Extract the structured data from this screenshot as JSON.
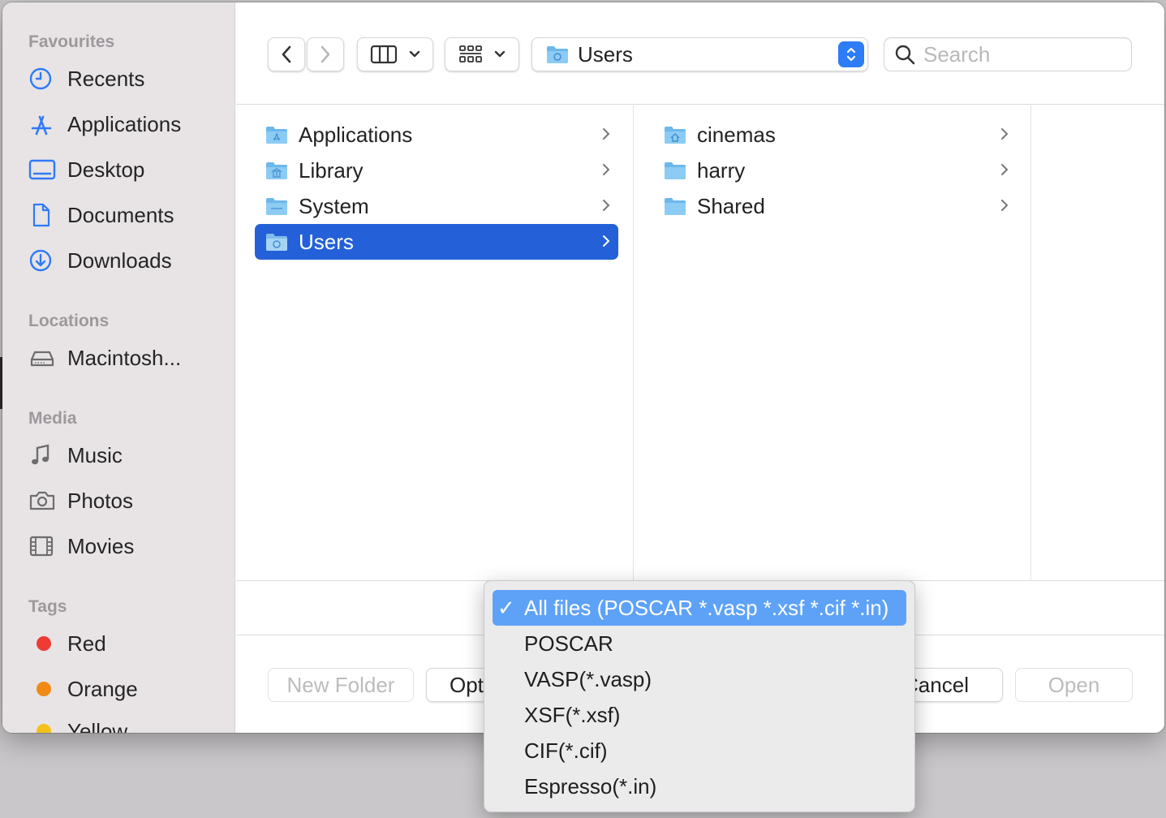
{
  "sidebar": {
    "sections": [
      {
        "heading": "Favourites",
        "items": [
          {
            "label": "Recents",
            "icon": "clock-icon"
          },
          {
            "label": "Applications",
            "icon": "applications-icon"
          },
          {
            "label": "Desktop",
            "icon": "desktop-icon"
          },
          {
            "label": "Documents",
            "icon": "document-icon"
          },
          {
            "label": "Downloads",
            "icon": "download-icon"
          }
        ]
      },
      {
        "heading": "Locations",
        "items": [
          {
            "label": "Macintosh...",
            "icon": "hard-drive-icon"
          }
        ]
      },
      {
        "heading": "Media",
        "items": [
          {
            "label": "Music",
            "icon": "music-note-icon"
          },
          {
            "label": "Photos",
            "icon": "camera-icon"
          },
          {
            "label": "Movies",
            "icon": "film-icon"
          }
        ]
      },
      {
        "heading": "Tags",
        "items": [
          {
            "label": "Red",
            "color": "#ee3b35"
          },
          {
            "label": "Orange",
            "color": "#f08a14"
          },
          {
            "label": "Yellow",
            "color": "#f3c21a"
          }
        ]
      }
    ]
  },
  "toolbar": {
    "path_label": "Users",
    "search_placeholder": "Search"
  },
  "columns": [
    {
      "items": [
        {
          "label": "Applications",
          "icon": "applications-folder-icon",
          "selected": false
        },
        {
          "label": "Library",
          "icon": "library-folder-icon",
          "selected": false
        },
        {
          "label": "System",
          "icon": "system-folder-icon",
          "selected": false
        },
        {
          "label": "Users",
          "icon": "users-folder-icon",
          "selected": true
        }
      ]
    },
    {
      "items": [
        {
          "label": "cinemas",
          "icon": "home-folder-icon",
          "selected": false
        },
        {
          "label": "harry",
          "icon": "folder-icon",
          "selected": false
        },
        {
          "label": "Shared",
          "icon": "folder-icon",
          "selected": false
        }
      ]
    }
  ],
  "buttons": {
    "new_folder": "New Folder",
    "options": "Options",
    "cancel": "Cancel",
    "open": "Open"
  },
  "file_type_menu": {
    "items": [
      {
        "label": "All files (POSCAR *.vasp *.xsf *.cif *.in)",
        "checked": true
      },
      {
        "label": "POSCAR",
        "checked": false
      },
      {
        "label": "VASP(*.vasp)",
        "checked": false
      },
      {
        "label": "XSF(*.xsf)",
        "checked": false
      },
      {
        "label": "CIF(*.cif)",
        "checked": false
      },
      {
        "label": "Espresso(*.in)",
        "checked": false
      }
    ],
    "check_glyph": "✓"
  },
  "colors": {
    "accent": "#2e7cf6",
    "selection": "#2461d8",
    "menu_highlight": "#5ea2f7",
    "folder": "#6cb8ec"
  }
}
